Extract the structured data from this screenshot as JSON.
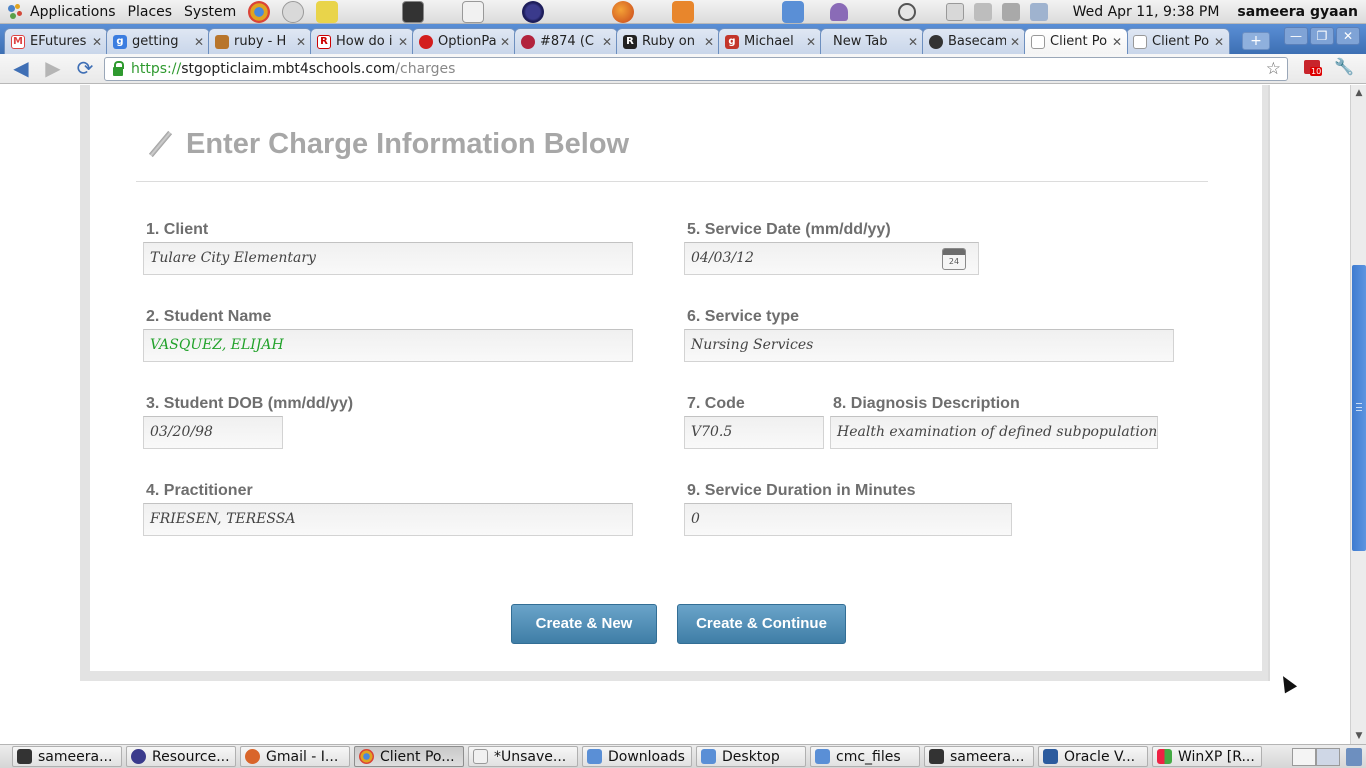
{
  "top_panel": {
    "menus": [
      "Applications",
      "Places",
      "System"
    ],
    "launchers": [
      "chrome-launcher-icon",
      "clock-app-icon",
      "notes-icon",
      "terminal-icon",
      "text-editor-icon",
      "eclipse-icon",
      "firefox-icon",
      "blender-icon",
      "folder-icon"
    ],
    "clock": "Wed Apr 11,  9:38 PM",
    "user": "sameera gyaan"
  },
  "tabs": [
    {
      "label": "EFutures",
      "icon": "gmail-icon",
      "active": false
    },
    {
      "label": "getting",
      "icon": "google-icon",
      "active": false
    },
    {
      "label": "ruby - H",
      "icon": "stackoverflow-icon",
      "active": false
    },
    {
      "label": "How do i",
      "icon": "r-icon",
      "active": false
    },
    {
      "label": "OptionPa",
      "icon": "red-dot-icon",
      "active": false
    },
    {
      "label": "#874 (C",
      "icon": "bug-icon",
      "active": false
    },
    {
      "label": "Ruby on",
      "icon": "rails-icon",
      "active": false
    },
    {
      "label": "Michael",
      "icon": "google-plus-icon",
      "active": false
    },
    {
      "label": "New Tab",
      "icon": "",
      "active": false
    },
    {
      "label": "Basecam",
      "icon": "basecamp-icon",
      "active": false
    },
    {
      "label": "Client Po",
      "icon": "page-icon",
      "active": true
    },
    {
      "label": "Client Po",
      "icon": "page-icon",
      "active": false
    }
  ],
  "toolbar": {
    "url_scheme": "https://",
    "url_host": "stgopticlaim.mbt4schools.com",
    "url_path": "/charges",
    "extension_badge": "10"
  },
  "form": {
    "title": "Enter Charge Information Below",
    "client": {
      "label": "1. Client",
      "value": "Tulare City Elementary"
    },
    "student_name": {
      "label": "2. Student Name",
      "value": "VASQUEZ, ELIJAH"
    },
    "student_dob": {
      "label": "3. Student DOB (mm/dd/yy)",
      "value": "03/20/98"
    },
    "practitioner": {
      "label": "4. Practitioner",
      "value": "FRIESEN, TERESSA"
    },
    "service_date": {
      "label": "5. Service Date (mm/dd/yy)",
      "value": "04/03/12",
      "calendar_day": "24"
    },
    "service_type": {
      "label": "6. Service type",
      "value": "Nursing Services"
    },
    "code": {
      "label": "7. Code",
      "value": "V70.5"
    },
    "diagnosis": {
      "label": "8. Diagnosis Description",
      "value": "Health examination of defined subpopulations"
    },
    "duration": {
      "label": "9. Service Duration in Minutes",
      "value": "0"
    },
    "create_new_label": "Create & New",
    "create_continue_label": "Create & Continue"
  },
  "taskbar": [
    {
      "label": "sameera...",
      "icon": "terminal-icon",
      "active": false
    },
    {
      "label": "Resource...",
      "icon": "eclipse-icon",
      "active": false
    },
    {
      "label": "Gmail - I...",
      "icon": "firefox-icon",
      "active": false
    },
    {
      "label": "Client Po...",
      "icon": "chrome-icon",
      "active": true
    },
    {
      "label": "*Unsave...",
      "icon": "text-editor-icon",
      "active": false
    },
    {
      "label": "Downloads",
      "icon": "folder-icon",
      "active": false
    },
    {
      "label": "Desktop",
      "icon": "folder-icon",
      "active": false
    },
    {
      "label": "cmc_files",
      "icon": "folder-icon",
      "active": false
    },
    {
      "label": "sameera...",
      "icon": "terminal-icon",
      "active": false
    },
    {
      "label": "Oracle V...",
      "icon": "virtualbox-icon",
      "active": false
    },
    {
      "label": "WinXP [R...",
      "icon": "windows-icon",
      "active": false
    }
  ],
  "colors": {
    "tab_strip": "#4a7fc7",
    "button": "#4f8db5",
    "student_name_text": "#22a22b",
    "title_text": "#a7a7a7"
  }
}
